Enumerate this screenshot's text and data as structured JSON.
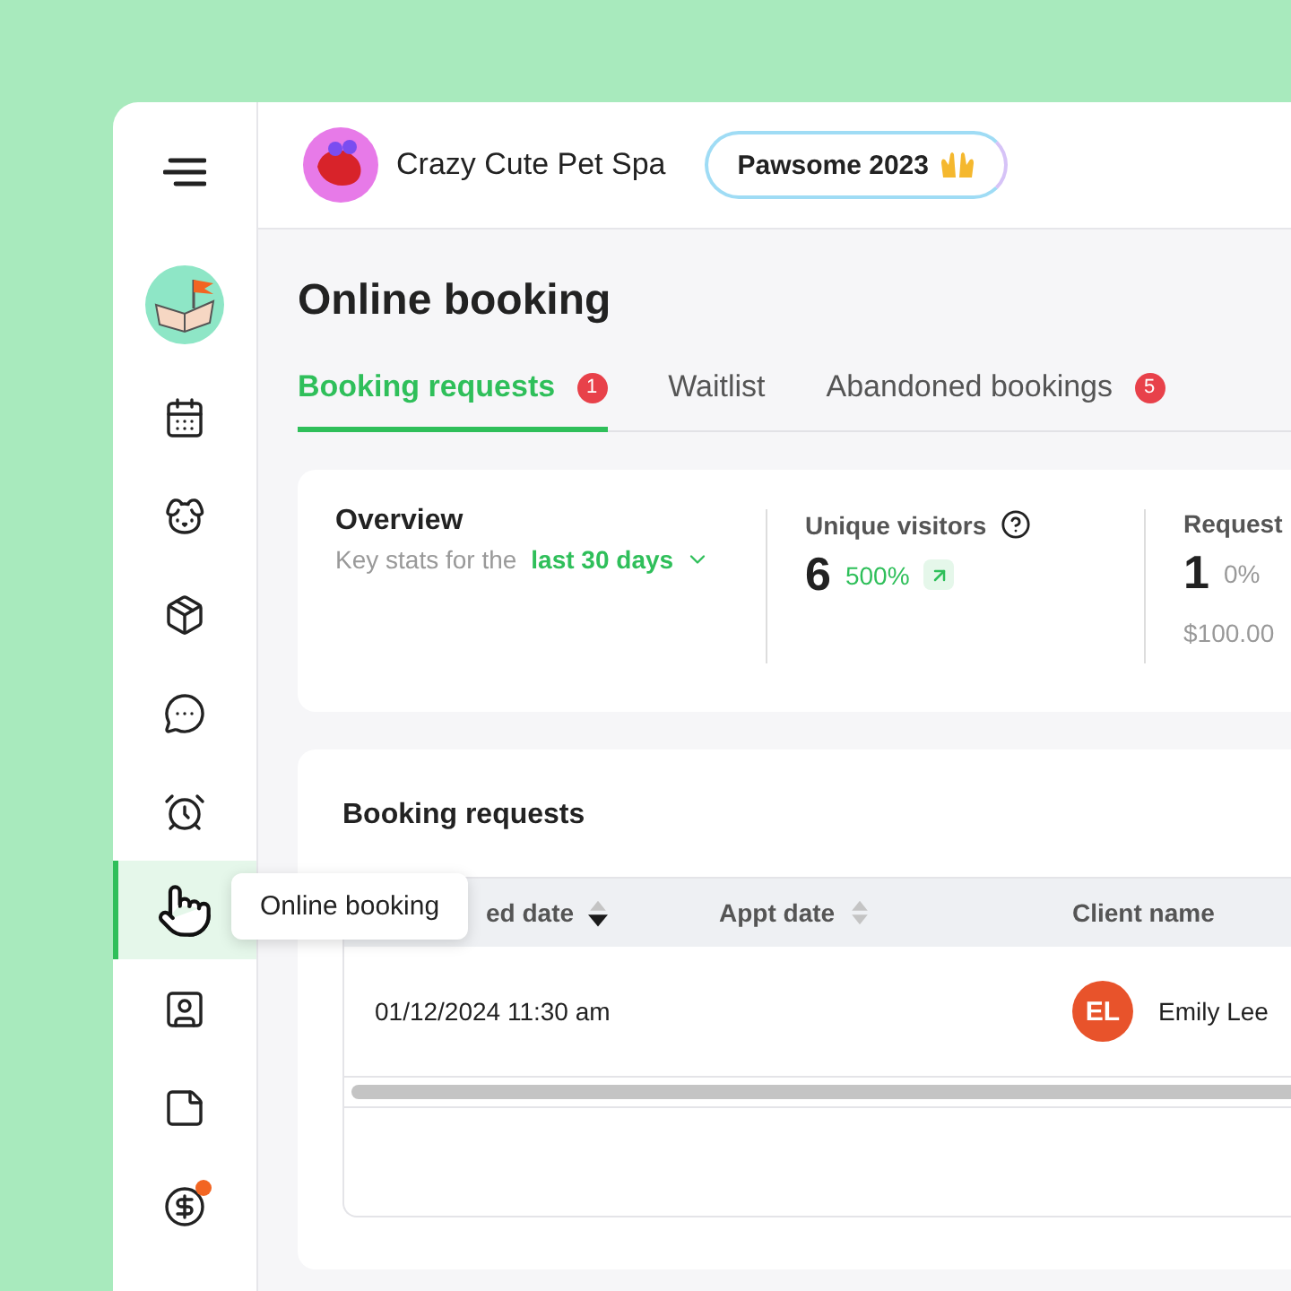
{
  "sidebar": {
    "items": [
      {
        "selected": false,
        "badge": false
      },
      {
        "selected": false,
        "badge": false
      },
      {
        "selected": false,
        "badge": false
      },
      {
        "selected": false,
        "badge": false
      },
      {
        "selected": false,
        "badge": false
      },
      {
        "selected": true,
        "badge": false
      },
      {
        "selected": false,
        "badge": false
      },
      {
        "selected": false,
        "badge": false
      },
      {
        "selected": false,
        "badge": true
      }
    ],
    "tooltip": "Online booking"
  },
  "header": {
    "business_name": "Crazy Cute Pet Spa",
    "promo": "Pawsome 2023"
  },
  "page_title": "Online booking",
  "tabs": [
    {
      "label": "Booking requests",
      "selected": true,
      "count": "1"
    },
    {
      "label": "Waitlist",
      "selected": false
    },
    {
      "label": "Abandoned bookings",
      "selected": false,
      "count": "5"
    }
  ],
  "overview": {
    "title": "Overview",
    "subtitle": "Key stats for the",
    "period": "last 30 days",
    "stats": [
      {
        "label": "Unique visitors",
        "help": true,
        "value": "6",
        "change": "500%",
        "rising": true
      },
      {
        "label": "Request",
        "help": false,
        "value": "1",
        "change": "0%",
        "rising": false,
        "amount": "$100.00"
      }
    ]
  },
  "table": {
    "title": "Booking requests",
    "columns": [
      {
        "label": "ed date",
        "sortable": true,
        "sorted": true
      },
      {
        "label": "Appt date",
        "sortable": true,
        "sorted": false
      },
      {
        "label": "Client name"
      }
    ],
    "rows": [
      {
        "requested": "01/12/2024 11:30 am",
        "client": {
          "initials": "EL",
          "name": "Emily Lee",
          "color": "#e8532b"
        }
      }
    ]
  }
}
